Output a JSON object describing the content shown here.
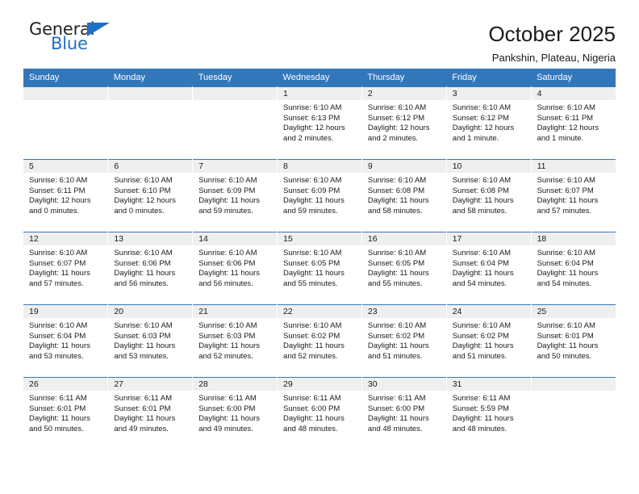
{
  "brand": {
    "name_top": "General",
    "name_bottom": "Blue",
    "triangle_color": "#1f6fc4",
    "text_color": "#221f1f"
  },
  "header": {
    "title": "October 2025",
    "subtitle": "Pankshin, Plateau, Nigeria"
  },
  "colors": {
    "header_row_background": "#3377bb",
    "header_row_text": "#ffffff",
    "date_band_background": "#efefef",
    "cell_background": "#ffffff",
    "row_divider": "#3377bb"
  },
  "weekday_headers": [
    "Sunday",
    "Monday",
    "Tuesday",
    "Wednesday",
    "Thursday",
    "Friday",
    "Saturday"
  ],
  "weeks": [
    [
      {
        "day": "",
        "empty": true,
        "sunrise": "",
        "sunset": "",
        "daylight_line1": "",
        "daylight_line2": ""
      },
      {
        "day": "",
        "empty": true,
        "sunrise": "",
        "sunset": "",
        "daylight_line1": "",
        "daylight_line2": ""
      },
      {
        "day": "",
        "empty": true,
        "sunrise": "",
        "sunset": "",
        "daylight_line1": "",
        "daylight_line2": ""
      },
      {
        "day": "1",
        "empty": false,
        "sunrise": "Sunrise: 6:10 AM",
        "sunset": "Sunset: 6:13 PM",
        "daylight_line1": "Daylight: 12 hours",
        "daylight_line2": "and 2 minutes."
      },
      {
        "day": "2",
        "empty": false,
        "sunrise": "Sunrise: 6:10 AM",
        "sunset": "Sunset: 6:12 PM",
        "daylight_line1": "Daylight: 12 hours",
        "daylight_line2": "and 2 minutes."
      },
      {
        "day": "3",
        "empty": false,
        "sunrise": "Sunrise: 6:10 AM",
        "sunset": "Sunset: 6:12 PM",
        "daylight_line1": "Daylight: 12 hours",
        "daylight_line2": "and 1 minute."
      },
      {
        "day": "4",
        "empty": false,
        "sunrise": "Sunrise: 6:10 AM",
        "sunset": "Sunset: 6:11 PM",
        "daylight_line1": "Daylight: 12 hours",
        "daylight_line2": "and 1 minute."
      }
    ],
    [
      {
        "day": "5",
        "empty": false,
        "sunrise": "Sunrise: 6:10 AM",
        "sunset": "Sunset: 6:11 PM",
        "daylight_line1": "Daylight: 12 hours",
        "daylight_line2": "and 0 minutes."
      },
      {
        "day": "6",
        "empty": false,
        "sunrise": "Sunrise: 6:10 AM",
        "sunset": "Sunset: 6:10 PM",
        "daylight_line1": "Daylight: 12 hours",
        "daylight_line2": "and 0 minutes."
      },
      {
        "day": "7",
        "empty": false,
        "sunrise": "Sunrise: 6:10 AM",
        "sunset": "Sunset: 6:09 PM",
        "daylight_line1": "Daylight: 11 hours",
        "daylight_line2": "and 59 minutes."
      },
      {
        "day": "8",
        "empty": false,
        "sunrise": "Sunrise: 6:10 AM",
        "sunset": "Sunset: 6:09 PM",
        "daylight_line1": "Daylight: 11 hours",
        "daylight_line2": "and 59 minutes."
      },
      {
        "day": "9",
        "empty": false,
        "sunrise": "Sunrise: 6:10 AM",
        "sunset": "Sunset: 6:08 PM",
        "daylight_line1": "Daylight: 11 hours",
        "daylight_line2": "and 58 minutes."
      },
      {
        "day": "10",
        "empty": false,
        "sunrise": "Sunrise: 6:10 AM",
        "sunset": "Sunset: 6:08 PM",
        "daylight_line1": "Daylight: 11 hours",
        "daylight_line2": "and 58 minutes."
      },
      {
        "day": "11",
        "empty": false,
        "sunrise": "Sunrise: 6:10 AM",
        "sunset": "Sunset: 6:07 PM",
        "daylight_line1": "Daylight: 11 hours",
        "daylight_line2": "and 57 minutes."
      }
    ],
    [
      {
        "day": "12",
        "empty": false,
        "sunrise": "Sunrise: 6:10 AM",
        "sunset": "Sunset: 6:07 PM",
        "daylight_line1": "Daylight: 11 hours",
        "daylight_line2": "and 57 minutes."
      },
      {
        "day": "13",
        "empty": false,
        "sunrise": "Sunrise: 6:10 AM",
        "sunset": "Sunset: 6:06 PM",
        "daylight_line1": "Daylight: 11 hours",
        "daylight_line2": "and 56 minutes."
      },
      {
        "day": "14",
        "empty": false,
        "sunrise": "Sunrise: 6:10 AM",
        "sunset": "Sunset: 6:06 PM",
        "daylight_line1": "Daylight: 11 hours",
        "daylight_line2": "and 56 minutes."
      },
      {
        "day": "15",
        "empty": false,
        "sunrise": "Sunrise: 6:10 AM",
        "sunset": "Sunset: 6:05 PM",
        "daylight_line1": "Daylight: 11 hours",
        "daylight_line2": "and 55 minutes."
      },
      {
        "day": "16",
        "empty": false,
        "sunrise": "Sunrise: 6:10 AM",
        "sunset": "Sunset: 6:05 PM",
        "daylight_line1": "Daylight: 11 hours",
        "daylight_line2": "and 55 minutes."
      },
      {
        "day": "17",
        "empty": false,
        "sunrise": "Sunrise: 6:10 AM",
        "sunset": "Sunset: 6:04 PM",
        "daylight_line1": "Daylight: 11 hours",
        "daylight_line2": "and 54 minutes."
      },
      {
        "day": "18",
        "empty": false,
        "sunrise": "Sunrise: 6:10 AM",
        "sunset": "Sunset: 6:04 PM",
        "daylight_line1": "Daylight: 11 hours",
        "daylight_line2": "and 54 minutes."
      }
    ],
    [
      {
        "day": "19",
        "empty": false,
        "sunrise": "Sunrise: 6:10 AM",
        "sunset": "Sunset: 6:04 PM",
        "daylight_line1": "Daylight: 11 hours",
        "daylight_line2": "and 53 minutes."
      },
      {
        "day": "20",
        "empty": false,
        "sunrise": "Sunrise: 6:10 AM",
        "sunset": "Sunset: 6:03 PM",
        "daylight_line1": "Daylight: 11 hours",
        "daylight_line2": "and 53 minutes."
      },
      {
        "day": "21",
        "empty": false,
        "sunrise": "Sunrise: 6:10 AM",
        "sunset": "Sunset: 6:03 PM",
        "daylight_line1": "Daylight: 11 hours",
        "daylight_line2": "and 52 minutes."
      },
      {
        "day": "22",
        "empty": false,
        "sunrise": "Sunrise: 6:10 AM",
        "sunset": "Sunset: 6:02 PM",
        "daylight_line1": "Daylight: 11 hours",
        "daylight_line2": "and 52 minutes."
      },
      {
        "day": "23",
        "empty": false,
        "sunrise": "Sunrise: 6:10 AM",
        "sunset": "Sunset: 6:02 PM",
        "daylight_line1": "Daylight: 11 hours",
        "daylight_line2": "and 51 minutes."
      },
      {
        "day": "24",
        "empty": false,
        "sunrise": "Sunrise: 6:10 AM",
        "sunset": "Sunset: 6:02 PM",
        "daylight_line1": "Daylight: 11 hours",
        "daylight_line2": "and 51 minutes."
      },
      {
        "day": "25",
        "empty": false,
        "sunrise": "Sunrise: 6:10 AM",
        "sunset": "Sunset: 6:01 PM",
        "daylight_line1": "Daylight: 11 hours",
        "daylight_line2": "and 50 minutes."
      }
    ],
    [
      {
        "day": "26",
        "empty": false,
        "sunrise": "Sunrise: 6:11 AM",
        "sunset": "Sunset: 6:01 PM",
        "daylight_line1": "Daylight: 11 hours",
        "daylight_line2": "and 50 minutes."
      },
      {
        "day": "27",
        "empty": false,
        "sunrise": "Sunrise: 6:11 AM",
        "sunset": "Sunset: 6:01 PM",
        "daylight_line1": "Daylight: 11 hours",
        "daylight_line2": "and 49 minutes."
      },
      {
        "day": "28",
        "empty": false,
        "sunrise": "Sunrise: 6:11 AM",
        "sunset": "Sunset: 6:00 PM",
        "daylight_line1": "Daylight: 11 hours",
        "daylight_line2": "and 49 minutes."
      },
      {
        "day": "29",
        "empty": false,
        "sunrise": "Sunrise: 6:11 AM",
        "sunset": "Sunset: 6:00 PM",
        "daylight_line1": "Daylight: 11 hours",
        "daylight_line2": "and 48 minutes."
      },
      {
        "day": "30",
        "empty": false,
        "sunrise": "Sunrise: 6:11 AM",
        "sunset": "Sunset: 6:00 PM",
        "daylight_line1": "Daylight: 11 hours",
        "daylight_line2": "and 48 minutes."
      },
      {
        "day": "31",
        "empty": false,
        "sunrise": "Sunrise: 6:11 AM",
        "sunset": "Sunset: 5:59 PM",
        "daylight_line1": "Daylight: 11 hours",
        "daylight_line2": "and 48 minutes."
      },
      {
        "day": "",
        "empty": true,
        "sunrise": "",
        "sunset": "",
        "daylight_line1": "",
        "daylight_line2": ""
      }
    ]
  ]
}
